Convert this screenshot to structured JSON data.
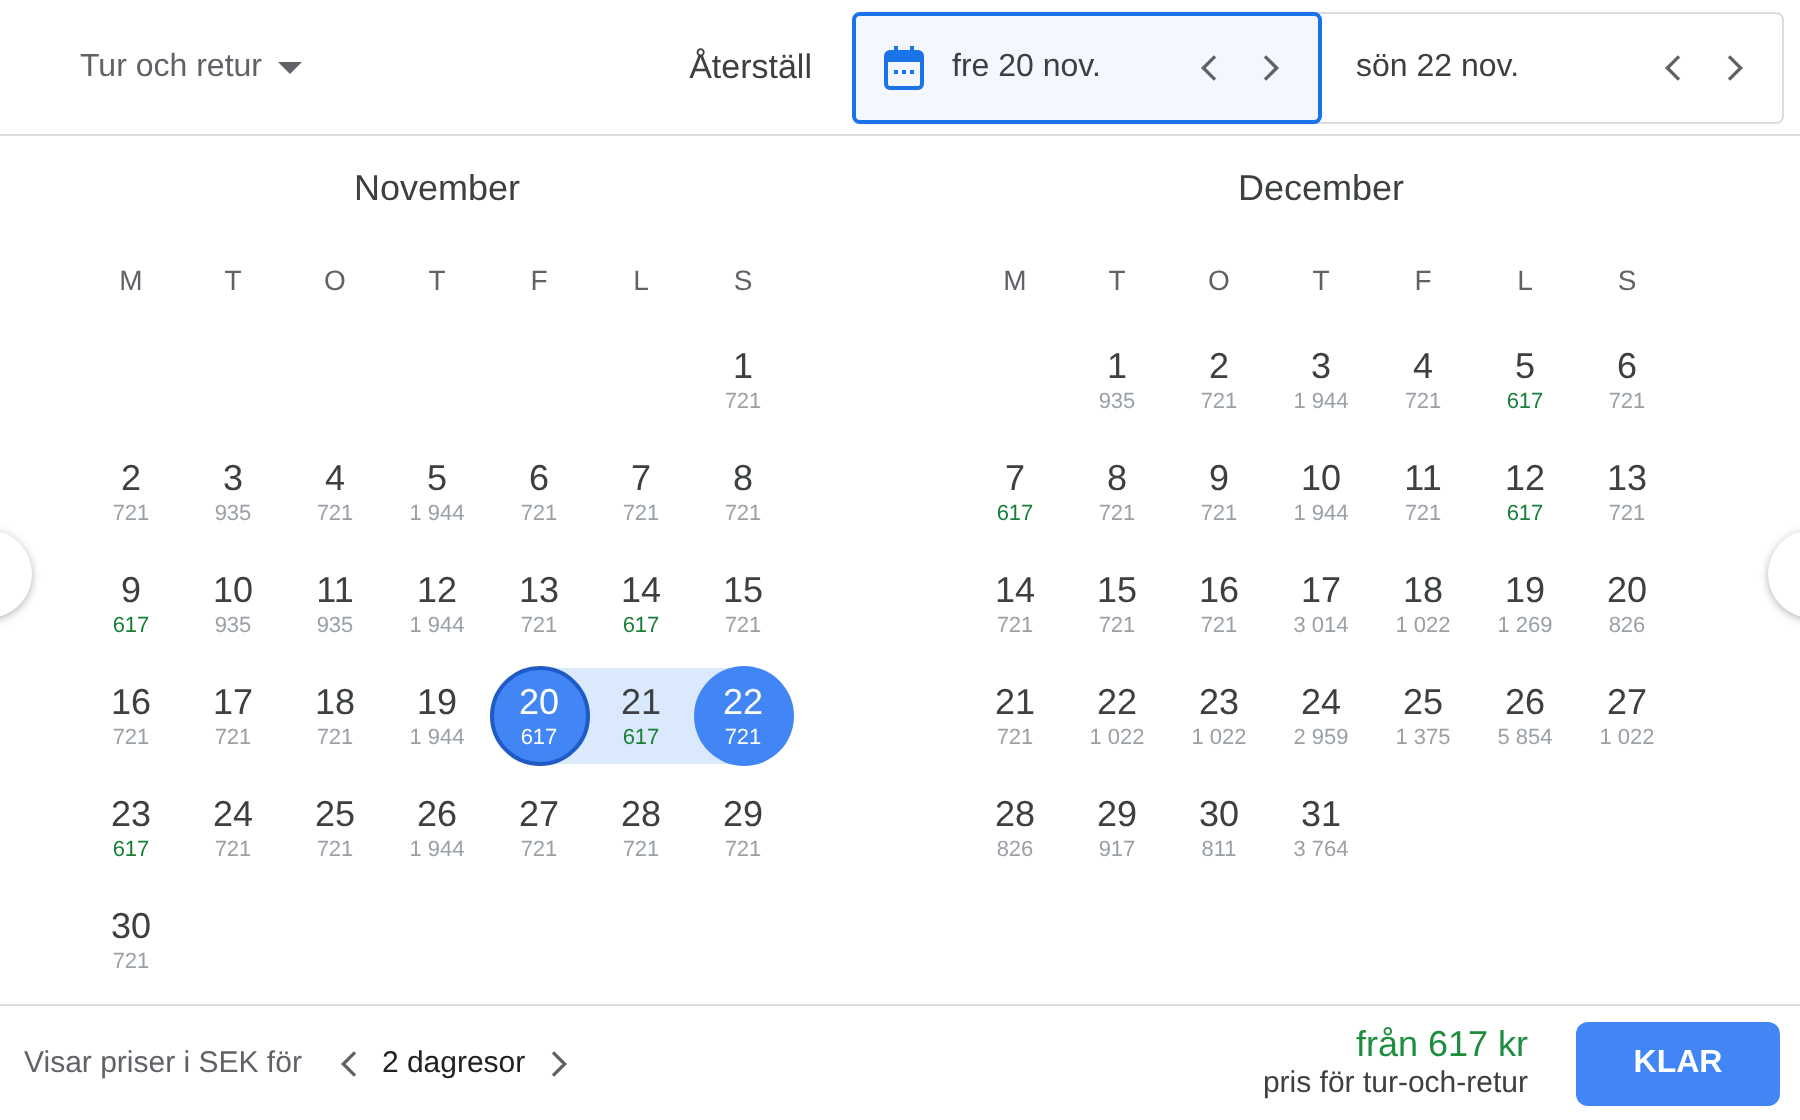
{
  "trip_type": {
    "label": "Tur och retur"
  },
  "reset_button": "Återställ",
  "date_fields": [
    {
      "label": "fre 20 nov.",
      "focused": true
    },
    {
      "label": "sön 22 nov.",
      "focused": false
    }
  ],
  "months": [
    {
      "name": "November",
      "weekdays": [
        "M",
        "T",
        "O",
        "T",
        "F",
        "L",
        "S"
      ],
      "weeks": [
        [
          {
            "day": "1",
            "price": "721",
            "cheapest": false,
            "selected": false,
            "in_range": false
          }
        ],
        [
          {
            "day": "2",
            "price": "721",
            "cheapest": false,
            "selected": false,
            "in_range": false
          },
          {
            "day": "3",
            "price": "935",
            "cheapest": false,
            "selected": false,
            "in_range": false
          },
          {
            "day": "4",
            "price": "721",
            "cheapest": false,
            "selected": false,
            "in_range": false
          },
          {
            "day": "5",
            "price": "1 944",
            "cheapest": false,
            "selected": false,
            "in_range": false
          },
          {
            "day": "6",
            "price": "721",
            "cheapest": false,
            "selected": false,
            "in_range": false
          },
          {
            "day": "7",
            "price": "721",
            "cheapest": false,
            "selected": false,
            "in_range": false
          },
          {
            "day": "8",
            "price": "721",
            "cheapest": false,
            "selected": false,
            "in_range": false
          }
        ],
        [
          {
            "day": "9",
            "price": "617",
            "cheapest": true,
            "selected": false,
            "in_range": false
          },
          {
            "day": "10",
            "price": "935",
            "cheapest": false,
            "selected": false,
            "in_range": false
          },
          {
            "day": "11",
            "price": "935",
            "cheapest": false,
            "selected": false,
            "in_range": false
          },
          {
            "day": "12",
            "price": "1 944",
            "cheapest": false,
            "selected": false,
            "in_range": false
          },
          {
            "day": "13",
            "price": "721",
            "cheapest": false,
            "selected": false,
            "in_range": false
          },
          {
            "day": "14",
            "price": "617",
            "cheapest": true,
            "selected": false,
            "in_range": false
          },
          {
            "day": "15",
            "price": "721",
            "cheapest": false,
            "selected": false,
            "in_range": false
          }
        ],
        [
          {
            "day": "16",
            "price": "721",
            "cheapest": false,
            "selected": false,
            "in_range": false
          },
          {
            "day": "17",
            "price": "721",
            "cheapest": false,
            "selected": false,
            "in_range": false
          },
          {
            "day": "18",
            "price": "721",
            "cheapest": false,
            "selected": false,
            "in_range": false
          },
          {
            "day": "19",
            "price": "1 944",
            "cheapest": false,
            "selected": false,
            "in_range": false
          },
          {
            "day": "20",
            "price": "617",
            "cheapest": true,
            "selected": true,
            "in_range": true
          },
          {
            "day": "21",
            "price": "617",
            "cheapest": true,
            "selected": false,
            "in_range": true
          },
          {
            "day": "22",
            "price": "721",
            "cheapest": false,
            "selected": true,
            "in_range": true
          }
        ],
        [
          {
            "day": "23",
            "price": "617",
            "cheapest": true,
            "selected": false,
            "in_range": false
          },
          {
            "day": "24",
            "price": "721",
            "cheapest": false,
            "selected": false,
            "in_range": false
          },
          {
            "day": "25",
            "price": "721",
            "cheapest": false,
            "selected": false,
            "in_range": false
          },
          {
            "day": "26",
            "price": "1 944",
            "cheapest": false,
            "selected": false,
            "in_range": false
          },
          {
            "day": "27",
            "price": "721",
            "cheapest": false,
            "selected": false,
            "in_range": false
          },
          {
            "day": "28",
            "price": "721",
            "cheapest": false,
            "selected": false,
            "in_range": false
          },
          {
            "day": "29",
            "price": "721",
            "cheapest": false,
            "selected": false,
            "in_range": false
          }
        ],
        [
          {
            "day": "30",
            "price": "721",
            "cheapest": false,
            "selected": false,
            "in_range": false
          }
        ]
      ]
    },
    {
      "name": "December",
      "weekdays": [
        "M",
        "T",
        "O",
        "T",
        "F",
        "L",
        "S"
      ],
      "weeks": [
        [
          {
            "day": "1",
            "price": "935",
            "cheapest": false,
            "selected": false,
            "in_range": false
          },
          {
            "day": "2",
            "price": "721",
            "cheapest": false,
            "selected": false,
            "in_range": false
          },
          {
            "day": "3",
            "price": "1 944",
            "cheapest": false,
            "selected": false,
            "in_range": false
          },
          {
            "day": "4",
            "price": "721",
            "cheapest": false,
            "selected": false,
            "in_range": false
          },
          {
            "day": "5",
            "price": "617",
            "cheapest": true,
            "selected": false,
            "in_range": false
          },
          {
            "day": "6",
            "price": "721",
            "cheapest": false,
            "selected": false,
            "in_range": false
          }
        ],
        [
          {
            "day": "7",
            "price": "617",
            "cheapest": true,
            "selected": false,
            "in_range": false
          },
          {
            "day": "8",
            "price": "721",
            "cheapest": false,
            "selected": false,
            "in_range": false
          },
          {
            "day": "9",
            "price": "721",
            "cheapest": false,
            "selected": false,
            "in_range": false
          },
          {
            "day": "10",
            "price": "1 944",
            "cheapest": false,
            "selected": false,
            "in_range": false
          },
          {
            "day": "11",
            "price": "721",
            "cheapest": false,
            "selected": false,
            "in_range": false
          },
          {
            "day": "12",
            "price": "617",
            "cheapest": true,
            "selected": false,
            "in_range": false
          },
          {
            "day": "13",
            "price": "721",
            "cheapest": false,
            "selected": false,
            "in_range": false
          }
        ],
        [
          {
            "day": "14",
            "price": "721",
            "cheapest": false,
            "selected": false,
            "in_range": false
          },
          {
            "day": "15",
            "price": "721",
            "cheapest": false,
            "selected": false,
            "in_range": false
          },
          {
            "day": "16",
            "price": "721",
            "cheapest": false,
            "selected": false,
            "in_range": false
          },
          {
            "day": "17",
            "price": "3 014",
            "cheapest": false,
            "selected": false,
            "in_range": false
          },
          {
            "day": "18",
            "price": "1 022",
            "cheapest": false,
            "selected": false,
            "in_range": false
          },
          {
            "day": "19",
            "price": "1 269",
            "cheapest": false,
            "selected": false,
            "in_range": false
          },
          {
            "day": "20",
            "price": "826",
            "cheapest": false,
            "selected": false,
            "in_range": false
          }
        ],
        [
          {
            "day": "21",
            "price": "721",
            "cheapest": false,
            "selected": false,
            "in_range": false
          },
          {
            "day": "22",
            "price": "1 022",
            "cheapest": false,
            "selected": false,
            "in_range": false
          },
          {
            "day": "23",
            "price": "1 022",
            "cheapest": false,
            "selected": false,
            "in_range": false
          },
          {
            "day": "24",
            "price": "2 959",
            "cheapest": false,
            "selected": false,
            "in_range": false
          },
          {
            "day": "25",
            "price": "1 375",
            "cheapest": false,
            "selected": false,
            "in_range": false
          },
          {
            "day": "26",
            "price": "5 854",
            "cheapest": false,
            "selected": false,
            "in_range": false
          },
          {
            "day": "27",
            "price": "1 022",
            "cheapest": false,
            "selected": false,
            "in_range": false
          }
        ],
        [
          {
            "day": "28",
            "price": "826",
            "cheapest": false,
            "selected": false,
            "in_range": false
          },
          {
            "day": "29",
            "price": "917",
            "cheapest": false,
            "selected": false,
            "in_range": false
          },
          {
            "day": "30",
            "price": "811",
            "cheapest": false,
            "selected": false,
            "in_range": false
          },
          {
            "day": "31",
            "price": "3 764",
            "cheapest": false,
            "selected": false,
            "in_range": false
          }
        ]
      ]
    }
  ],
  "footer": {
    "currency_note": "Visar priser i SEK för",
    "trip_length": "2 dagresor",
    "price": "från 617 kr",
    "price_note": "pris för tur-och-retur",
    "done_button": "KLAR"
  }
}
